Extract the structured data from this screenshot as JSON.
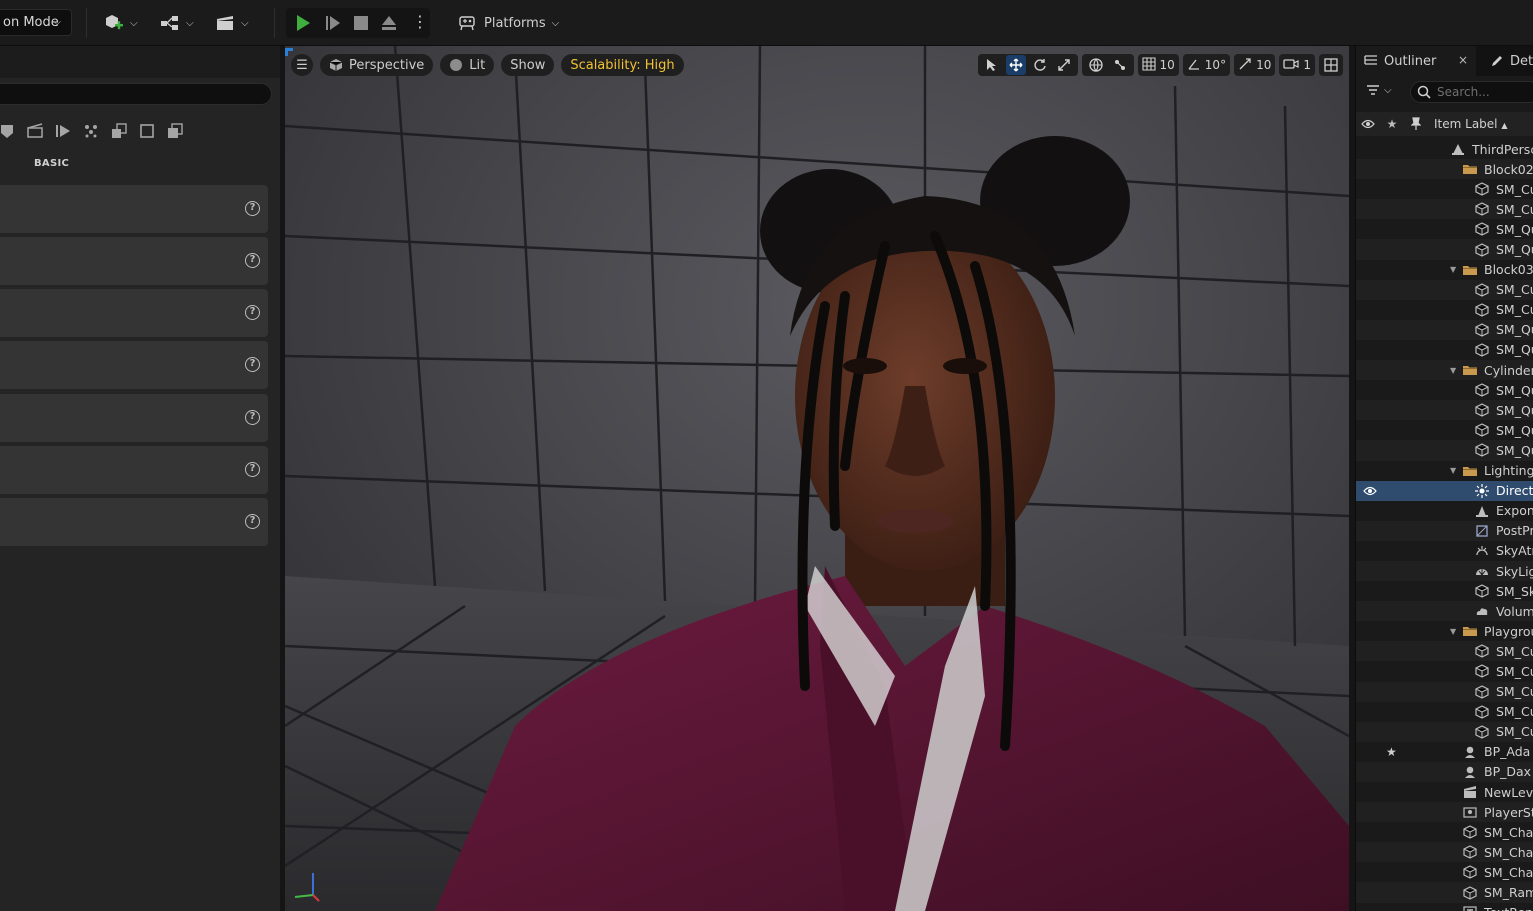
{
  "toolbar": {
    "mode_label": "on Mode",
    "platforms_label": "Platforms"
  },
  "left_panel": {
    "section_label": "BASIC",
    "rows": [
      {
        "help": "?"
      },
      {
        "help": "?"
      },
      {
        "help": "?"
      },
      {
        "help": "?"
      },
      {
        "help": "?"
      },
      {
        "help": "?"
      },
      {
        "help": "?"
      }
    ]
  },
  "viewport": {
    "view_mode": "Perspective",
    "lighting": "Lit",
    "show": "Show",
    "scalability": "Scalability: High",
    "grid_snap": "10",
    "rotation_snap": "10°",
    "scale_snap": "10",
    "camera_speed": "1"
  },
  "outliner": {
    "tab_label": "Outliner",
    "close_glyph": "×",
    "details_tab_label": "Deta",
    "search_placeholder": "Search...",
    "column_label": "Item Label",
    "sort_glyph": "▲",
    "rows": [
      {
        "label": "ThirdPersc",
        "indent": 0,
        "icon": "level-icon",
        "folder": false,
        "open": false
      },
      {
        "label": "Block02",
        "indent": 1,
        "icon": "folder-icon",
        "folder": true,
        "open": false
      },
      {
        "label": "SM_Cu",
        "indent": 2,
        "icon": "mesh-icon"
      },
      {
        "label": "SM_Cu",
        "indent": 2,
        "icon": "mesh-icon"
      },
      {
        "label": "SM_Qu",
        "indent": 2,
        "icon": "mesh-icon"
      },
      {
        "label": "SM_Qu",
        "indent": 2,
        "icon": "mesh-icon"
      },
      {
        "label": "Block03",
        "indent": 1,
        "icon": "folder-icon",
        "folder": true,
        "open": true
      },
      {
        "label": "SM_Cu",
        "indent": 2,
        "icon": "mesh-icon"
      },
      {
        "label": "SM_Cu",
        "indent": 2,
        "icon": "mesh-icon"
      },
      {
        "label": "SM_Qu",
        "indent": 2,
        "icon": "mesh-icon"
      },
      {
        "label": "SM_Qu",
        "indent": 2,
        "icon": "mesh-icon"
      },
      {
        "label": "Cylinder",
        "indent": 1,
        "icon": "folder-icon",
        "folder": true,
        "open": true
      },
      {
        "label": "SM_Qu",
        "indent": 2,
        "icon": "mesh-icon"
      },
      {
        "label": "SM_Qu",
        "indent": 2,
        "icon": "mesh-icon"
      },
      {
        "label": "SM_Qu",
        "indent": 2,
        "icon": "mesh-icon"
      },
      {
        "label": "SM_Qu",
        "indent": 2,
        "icon": "mesh-icon"
      },
      {
        "label": "Lighting",
        "indent": 1,
        "icon": "folder-icon",
        "folder": true,
        "open": true
      },
      {
        "label": "Directi",
        "indent": 2,
        "icon": "sun-icon",
        "selected": true,
        "eye": true
      },
      {
        "label": "Expon",
        "indent": 2,
        "icon": "fog-icon"
      },
      {
        "label": "PostPr",
        "indent": 2,
        "icon": "postprocess-icon"
      },
      {
        "label": "SkyAtı",
        "indent": 2,
        "icon": "sky-atmosphere-icon"
      },
      {
        "label": "SkyLig",
        "indent": 2,
        "icon": "skylight-icon"
      },
      {
        "label": "SM_Sk",
        "indent": 2,
        "icon": "mesh-icon"
      },
      {
        "label": "Volum",
        "indent": 2,
        "icon": "cloud-icon"
      },
      {
        "label": "Playgrou",
        "indent": 1,
        "icon": "folder-icon",
        "folder": true,
        "open": true
      },
      {
        "label": "SM_Cu",
        "indent": 2,
        "icon": "mesh-icon"
      },
      {
        "label": "SM_Cu",
        "indent": 2,
        "icon": "mesh-icon"
      },
      {
        "label": "SM_Cu",
        "indent": 2,
        "icon": "mesh-icon"
      },
      {
        "label": "SM_Cu",
        "indent": 2,
        "icon": "mesh-icon"
      },
      {
        "label": "SM_Cu",
        "indent": 2,
        "icon": "mesh-icon"
      },
      {
        "label": "BP_Ada",
        "indent": 1,
        "icon": "pawn-icon",
        "star": true
      },
      {
        "label": "BP_Dax",
        "indent": 1,
        "icon": "pawn-icon"
      },
      {
        "label": "NewLev",
        "indent": 1,
        "icon": "sequence-icon"
      },
      {
        "label": "PlayerSt",
        "indent": 1,
        "icon": "player-start-icon"
      },
      {
        "label": "SM_Chai",
        "indent": 1,
        "icon": "mesh-icon"
      },
      {
        "label": "SM_Chai",
        "indent": 1,
        "icon": "mesh-icon"
      },
      {
        "label": "SM_Chai",
        "indent": 1,
        "icon": "mesh-icon"
      },
      {
        "label": "SM_Ram",
        "indent": 1,
        "icon": "mesh-icon"
      },
      {
        "label": "TextRen",
        "indent": 1,
        "icon": "text-render-icon"
      }
    ]
  },
  "colors": {
    "accent_blue": "#2b7fd6",
    "play_green": "#3fae3f",
    "scalability_yellow": "#f1c232",
    "selection": "#2f4c6e",
    "shirt": "#5c1634"
  }
}
